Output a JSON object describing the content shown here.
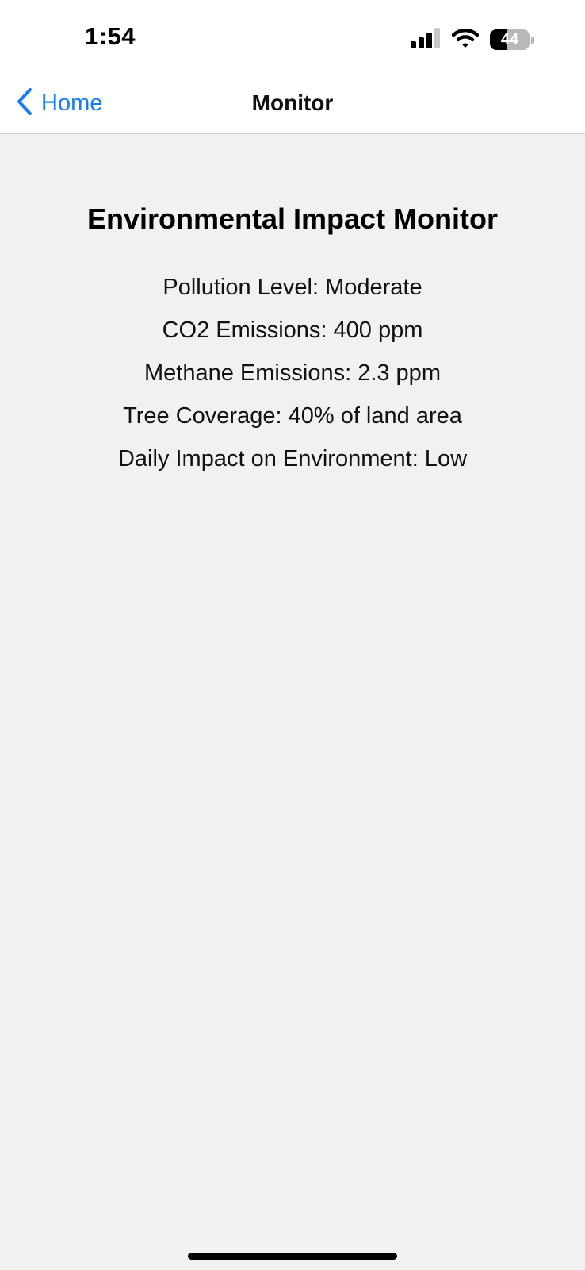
{
  "status_bar": {
    "time": "1:54",
    "battery_level": "44",
    "battery_fraction": 0.44,
    "icons": [
      "cellular-signal-icon",
      "wifi-icon",
      "battery-icon"
    ]
  },
  "nav": {
    "back_label": "Home",
    "title": "Monitor",
    "accent_color": "#1a7cf0"
  },
  "main": {
    "title": "Environmental Impact Monitor",
    "metrics": [
      "Pollution Level: Moderate",
      "CO2 Emissions: 400 ppm",
      "Methane Emissions: 2.3 ppm",
      "Tree Coverage: 40% of land area",
      "Daily Impact on Environment: Low"
    ]
  }
}
